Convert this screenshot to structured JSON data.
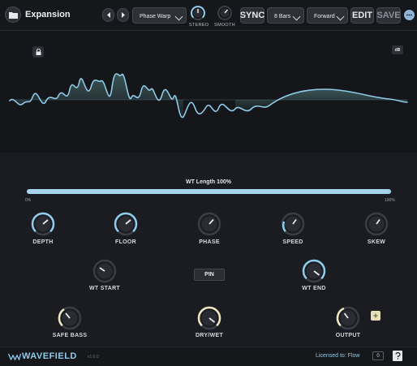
{
  "header": {
    "preset_name": "Expansion",
    "mode_select": "Phase Warp",
    "stereo_label": "STEREO",
    "smooth_label": "SMOOTH",
    "sync_label": "SYNC",
    "bars_select": "8 Bars",
    "direction_select": "Forward",
    "edit_label": "EDIT",
    "save_label": "SAVE"
  },
  "waveform": {
    "db_label": "dB"
  },
  "wt_length": {
    "label": "WT Length 100%",
    "value_percent": 100,
    "min_label": "0%",
    "max_label": "100%"
  },
  "knobs": {
    "depth": "DEPTH",
    "floor": "FLOOR",
    "phase": "PHASE",
    "speed": "SPEED",
    "skew": "SKEW",
    "wt_start": "WT START",
    "wt_end": "WT END",
    "safe_bass": "SAFE BASS",
    "dry_wet": "DRY/WET",
    "output": "OUTPUT"
  },
  "pin_label": "PIN",
  "footer": {
    "brand": "WAVEFIELD",
    "version": "v1.0.0",
    "licensed_prefix": "Licensed to:",
    "licensed_name": "Flow",
    "counter": "0"
  },
  "colors": {
    "accent_blue": "#8fcbea",
    "accent_cream": "#efe7c2",
    "background": "#1b1c21"
  }
}
